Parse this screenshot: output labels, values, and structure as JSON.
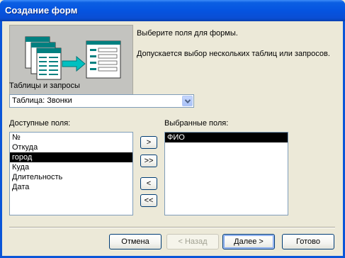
{
  "window": {
    "title": "Создание форм"
  },
  "banner": {
    "line1": "Выберите поля для формы.",
    "line2": "Допускается выбор нескольких таблиц или запросов."
  },
  "tables": {
    "label": "Таблицы и запросы",
    "selected": "Таблица: Звонки"
  },
  "available": {
    "label": "Доступные поля:",
    "items": [
      "№",
      "Откуда",
      "город",
      "Куда",
      "Длительность",
      "Дата"
    ],
    "selected_index": 2
  },
  "chosen": {
    "label": "Выбранные поля:",
    "items": [
      "ФИО"
    ],
    "selected_index": 0
  },
  "move_buttons": {
    "add_one": ">",
    "add_all": ">>",
    "remove_one": "<",
    "remove_all": "<<"
  },
  "footer": {
    "cancel": "Отмена",
    "back": "< Назад",
    "next": "Далее >",
    "finish": "Готово",
    "back_enabled": false
  },
  "colors": {
    "title_bar": "#0554e0",
    "dialog_bg": "#ece9d8",
    "selection": "#000000"
  }
}
